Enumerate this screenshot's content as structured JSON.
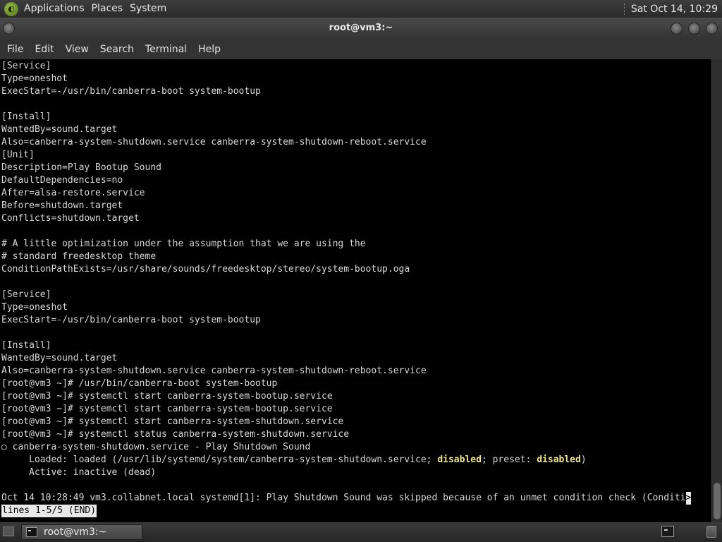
{
  "top_panel": {
    "menus": [
      "Applications",
      "Places",
      "System"
    ],
    "clock": "Sat Oct 14, 10:29"
  },
  "window": {
    "title": "root@vm3:~"
  },
  "menubar": {
    "items": [
      "File",
      "Edit",
      "View",
      "Search",
      "Terminal",
      "Help"
    ]
  },
  "terminal": {
    "lines": [
      "[Service]",
      "Type=oneshot",
      "ExecStart=-/usr/bin/canberra-boot system-bootup",
      "",
      "[Install]",
      "WantedBy=sound.target",
      "Also=canberra-system-shutdown.service canberra-system-shutdown-reboot.service",
      "[Unit]",
      "Description=Play Bootup Sound",
      "DefaultDependencies=no",
      "After=alsa-restore.service",
      "Before=shutdown.target",
      "Conflicts=shutdown.target",
      "",
      "# A little optimization under the assumption that we are using the",
      "# standard freedesktop theme",
      "ConditionPathExists=/usr/share/sounds/freedesktop/stereo/system-bootup.oga",
      "",
      "[Service]",
      "Type=oneshot",
      "ExecStart=-/usr/bin/canberra-boot system-bootup",
      "",
      "[Install]",
      "WantedBy=sound.target",
      "Also=canberra-system-shutdown.service canberra-system-shutdown-reboot.service",
      "[root@vm3 ~]# /usr/bin/canberra-boot system-bootup",
      "[root@vm3 ~]# systemctl start canberra-system-bootup.service",
      "[root@vm3 ~]# systemctl start canberra-system-bootup.service",
      "[root@vm3 ~]# systemctl start canberra-system-shutdown.service",
      "[root@vm3 ~]# systemctl status canberra-system-shutdown.service",
      "○ canberra-system-shutdown.service - Play Shutdown Sound"
    ],
    "loaded": {
      "prefix": "     Loaded: loaded (/usr/lib/systemd/system/canberra-system-shutdown.service; ",
      "disabled1": "disabled",
      "mid": "; preset: ",
      "disabled2": "disabled",
      "suffix": ")"
    },
    "active": "     Active: inactive (dead)",
    "log_line": "Oct 14 10:28:49 vm3.collabnet.local systemd[1]: Play Shutdown Sound was skipped because of an unmet condition check (Conditi",
    "truncation_marker": ">",
    "pager_status": "lines 1-5/5 (END)"
  },
  "taskbar": {
    "window_button": "root@vm3:~"
  }
}
